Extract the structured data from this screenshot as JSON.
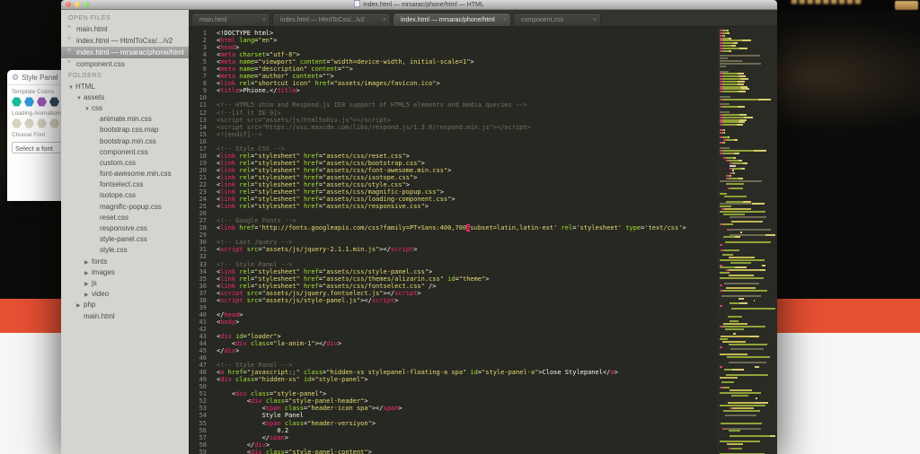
{
  "window": {
    "title": "index.html — mrsarac/phone/html — HTML"
  },
  "tabs": [
    {
      "label": "main.html",
      "active": false
    },
    {
      "label": "index.html — HtmlToCss/.../v2",
      "active": false
    },
    {
      "label": "index.html — mrsarac/phone/html",
      "active": true
    },
    {
      "label": "component.css",
      "active": false
    }
  ],
  "sidebar": {
    "open_files_header": "OPEN FILES",
    "open_files": [
      {
        "label": "main.html",
        "selected": false
      },
      {
        "label": "index.html — HtmlToCss/.../v2",
        "selected": false
      },
      {
        "label": "index.html — mrsarac/phone/html",
        "selected": true
      },
      {
        "label": "component.css",
        "selected": false
      }
    ],
    "folders_header": "FOLDERS",
    "tree": [
      {
        "label": "HTML",
        "indent": 0,
        "arrow": "down"
      },
      {
        "label": "assets",
        "indent": 1,
        "arrow": "down"
      },
      {
        "label": "css",
        "indent": 2,
        "arrow": "down"
      },
      {
        "label": "animate.min.css",
        "indent": 3,
        "arrow": "none"
      },
      {
        "label": "bootstrap.css.map",
        "indent": 3,
        "arrow": "none"
      },
      {
        "label": "bootstrap.min.css",
        "indent": 3,
        "arrow": "none"
      },
      {
        "label": "component.css",
        "indent": 3,
        "arrow": "none"
      },
      {
        "label": "custom.css",
        "indent": 3,
        "arrow": "none"
      },
      {
        "label": "font-awesome.min.css",
        "indent": 3,
        "arrow": "none"
      },
      {
        "label": "fontselect.css",
        "indent": 3,
        "arrow": "none"
      },
      {
        "label": "isotope.css",
        "indent": 3,
        "arrow": "none"
      },
      {
        "label": "magnific-popup.css",
        "indent": 3,
        "arrow": "none"
      },
      {
        "label": "reset.css",
        "indent": 3,
        "arrow": "none"
      },
      {
        "label": "responsive.css",
        "indent": 3,
        "arrow": "none"
      },
      {
        "label": "style-panel.css",
        "indent": 3,
        "arrow": "none"
      },
      {
        "label": "style.css",
        "indent": 3,
        "arrow": "none"
      },
      {
        "label": "fonts",
        "indent": 2,
        "arrow": "right"
      },
      {
        "label": "images",
        "indent": 2,
        "arrow": "right"
      },
      {
        "label": "js",
        "indent": 2,
        "arrow": "right"
      },
      {
        "label": "video",
        "indent": 2,
        "arrow": "right"
      },
      {
        "label": "php",
        "indent": 1,
        "arrow": "right"
      },
      {
        "label": "main.html",
        "indent": 1,
        "arrow": "none"
      }
    ]
  },
  "editor": {
    "first_line_number": 1,
    "cursor": {
      "line": 28,
      "before_text": "subset"
    },
    "colors": {
      "background": "#272822",
      "tag": "#f92672",
      "attribute": "#a6e22e",
      "string": "#e6db74",
      "comment": "#75715e",
      "text": "#f8f8f2"
    },
    "code_lines": [
      "<!DOCTYPE html>",
      "<html lang=\"en\">",
      "<head>",
      "<meta charset=\"utf-8\">",
      "<meta name=\"viewport\" content=\"width=device-width, initial-scale=1\">",
      "<meta name=\"description\" content=\"\">",
      "<meta name=\"author\" content=\"\">",
      "<link rel=\"shortcut icon\" href=\"assets/images/favicon.ico\">",
      "<title>Phione.</title>",
      "",
      "<!-- HTML5 shim and Respond.js IE8 support of HTML5 elements and media queries -->",
      "<!--[if lt IE 9]>",
      "<script src=\"assets/js/html5shiv.js\"></script>",
      "<script src=\"https://oss.maxcdn.com/libs/respond.js/1.3.0/respond.min.js\"></script>",
      "<![endif]-->",
      "",
      "<!-- Style CSS -->",
      "<link rel=\"stylesheet\" href=\"assets/css/reset.css\">",
      "<link rel=\"stylesheet\" href=\"assets/css/bootstrap.css\">",
      "<link rel=\"stylesheet\" href=\"assets/css/font-awesome.min.css\">",
      "<link rel=\"stylesheet\" href=\"assets/css/isotope.css\">",
      "<link rel=\"stylesheet\" href=\"assets/css/style.css\">",
      "<link rel=\"stylesheet\" href=\"assets/css/magnific-popup.css\">",
      "<link rel=\"stylesheet\" href=\"assets/css/loading-component.css\">",
      "<link rel=\"stylesheet\" href=\"assets/css/responsive.css\">",
      "",
      "<!-- Google Fonts -->",
      "<link href='http://fonts.googleapis.com/css?family=PT+Sans:400,700&subset=latin,latin-ext' rel='stylesheet' type='text/css'>",
      "",
      "<!-- Last Jquery -->",
      "<script src=\"assets/js/jquery-2.1.1.min.js\"></script>",
      "",
      "<!-- Style Panel -->",
      "<link rel=\"stylesheet\" href=\"assets/css/style-panel.css\">",
      "<link rel=\"stylesheet\" href=\"assets/css/themes/alizarin.css\" id=\"theme\">",
      "<link rel=\"stylesheet\" href=\"assets/css/fontselect.css\" />",
      "<script src=\"assets/js/jquery.fontselect.js\"></script>",
      "<script src=\"assets/js/style-panel.js\"></script>",
      "",
      "</head>",
      "<body>",
      "",
      "<div id=\"loader\">",
      "    <div class=\"la-anim-1\"></div>",
      "</div>",
      "",
      "<!-- Style Panel -->",
      "<a href=\"javascript:;\" class=\"hidden-xs stylepanel-floating-a spa\" id=\"style-panel-a\">Close Stylepanel</a>",
      "<div class=\"hidden-xs\" id=\"style-panel\">",
      "",
      "    <div class=\"style-panel\">",
      "        <div class=\"style-panel-header\">",
      "            <span class=\"header-icon spa\"></span>",
      "            Style Panel",
      "            <span class=\"header-versiyon\">",
      "                0.2",
      "            </span>",
      "        </div>",
      "        <div class=\"style-panel-content\">"
    ]
  },
  "style_panel_window": {
    "title": "Style Panel",
    "template_colors_label": "Template Colors",
    "template_colors": [
      "#1abc9c",
      "#3498db",
      "#9b59b6",
      "#34495e"
    ],
    "loading_animations_label": "Loading Animations",
    "loading_hex_color": "#d9d3c2",
    "loading_hex_count": 4,
    "choose_font_label": "Choose Font",
    "font_box_text": "Select a font"
  },
  "background_page": {
    "accent_band_color": "#e55032"
  }
}
